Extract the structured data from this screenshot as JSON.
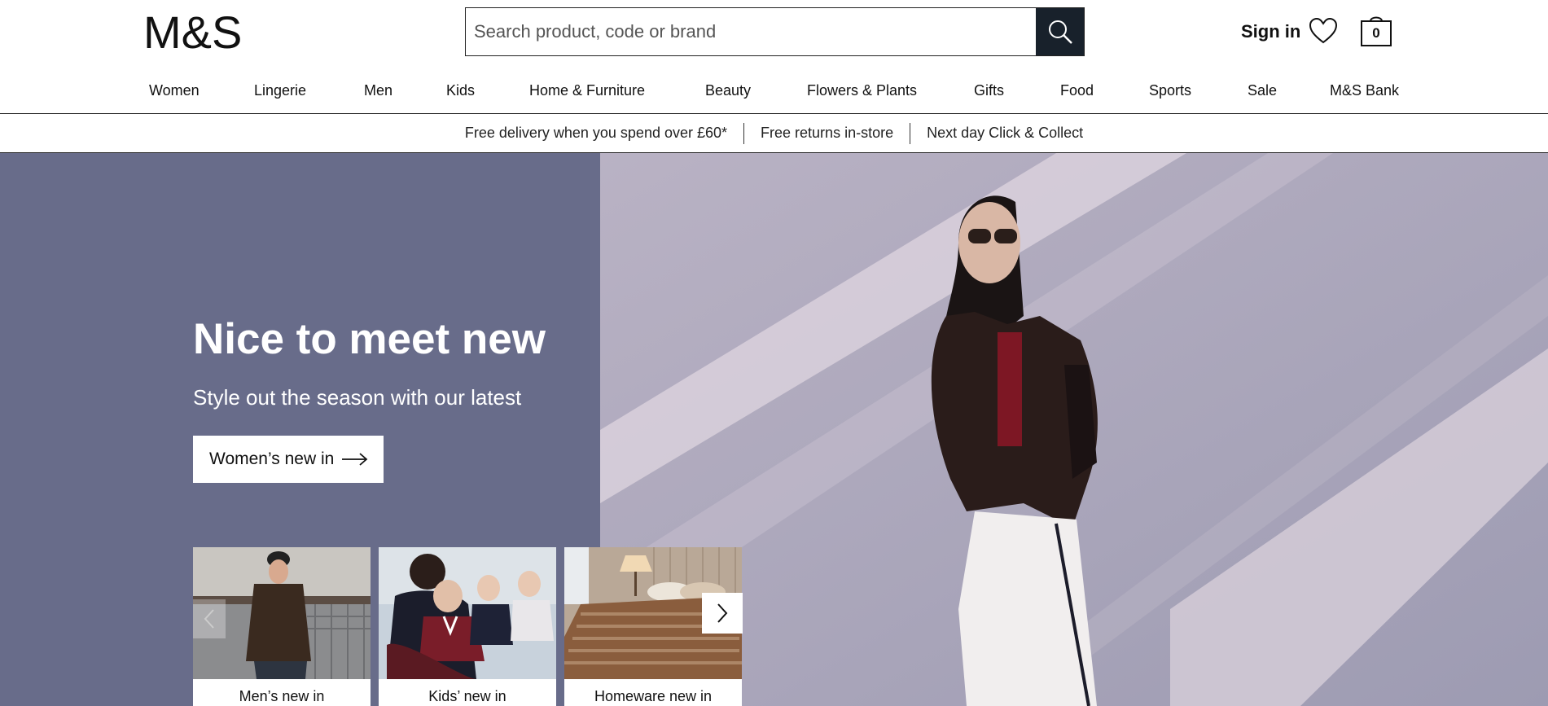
{
  "header": {
    "logo_text": "M&S",
    "search_placeholder": "Search product, code or brand",
    "signin_label": "Sign in",
    "bag_count": "0"
  },
  "nav": {
    "items": [
      "Women",
      "Lingerie",
      "Men",
      "Kids",
      "Home & Furniture",
      "Beauty",
      "Flowers & Plants",
      "Gifts",
      "Food",
      "Sports",
      "Sale",
      "M&S Bank"
    ]
  },
  "promo": {
    "items": [
      "Free delivery when you spend over £60*",
      "Free returns in-store",
      "Next day Click & Collect"
    ]
  },
  "hero": {
    "title": "Nice to meet new",
    "subtitle": "Style out the season with our latest",
    "cta_label": "Women’s new in",
    "bg_color": "#686c8a"
  },
  "tiles": [
    {
      "label": "Men’s new in"
    },
    {
      "label": "Kids’ new in"
    },
    {
      "label": "Homeware new in"
    }
  ]
}
